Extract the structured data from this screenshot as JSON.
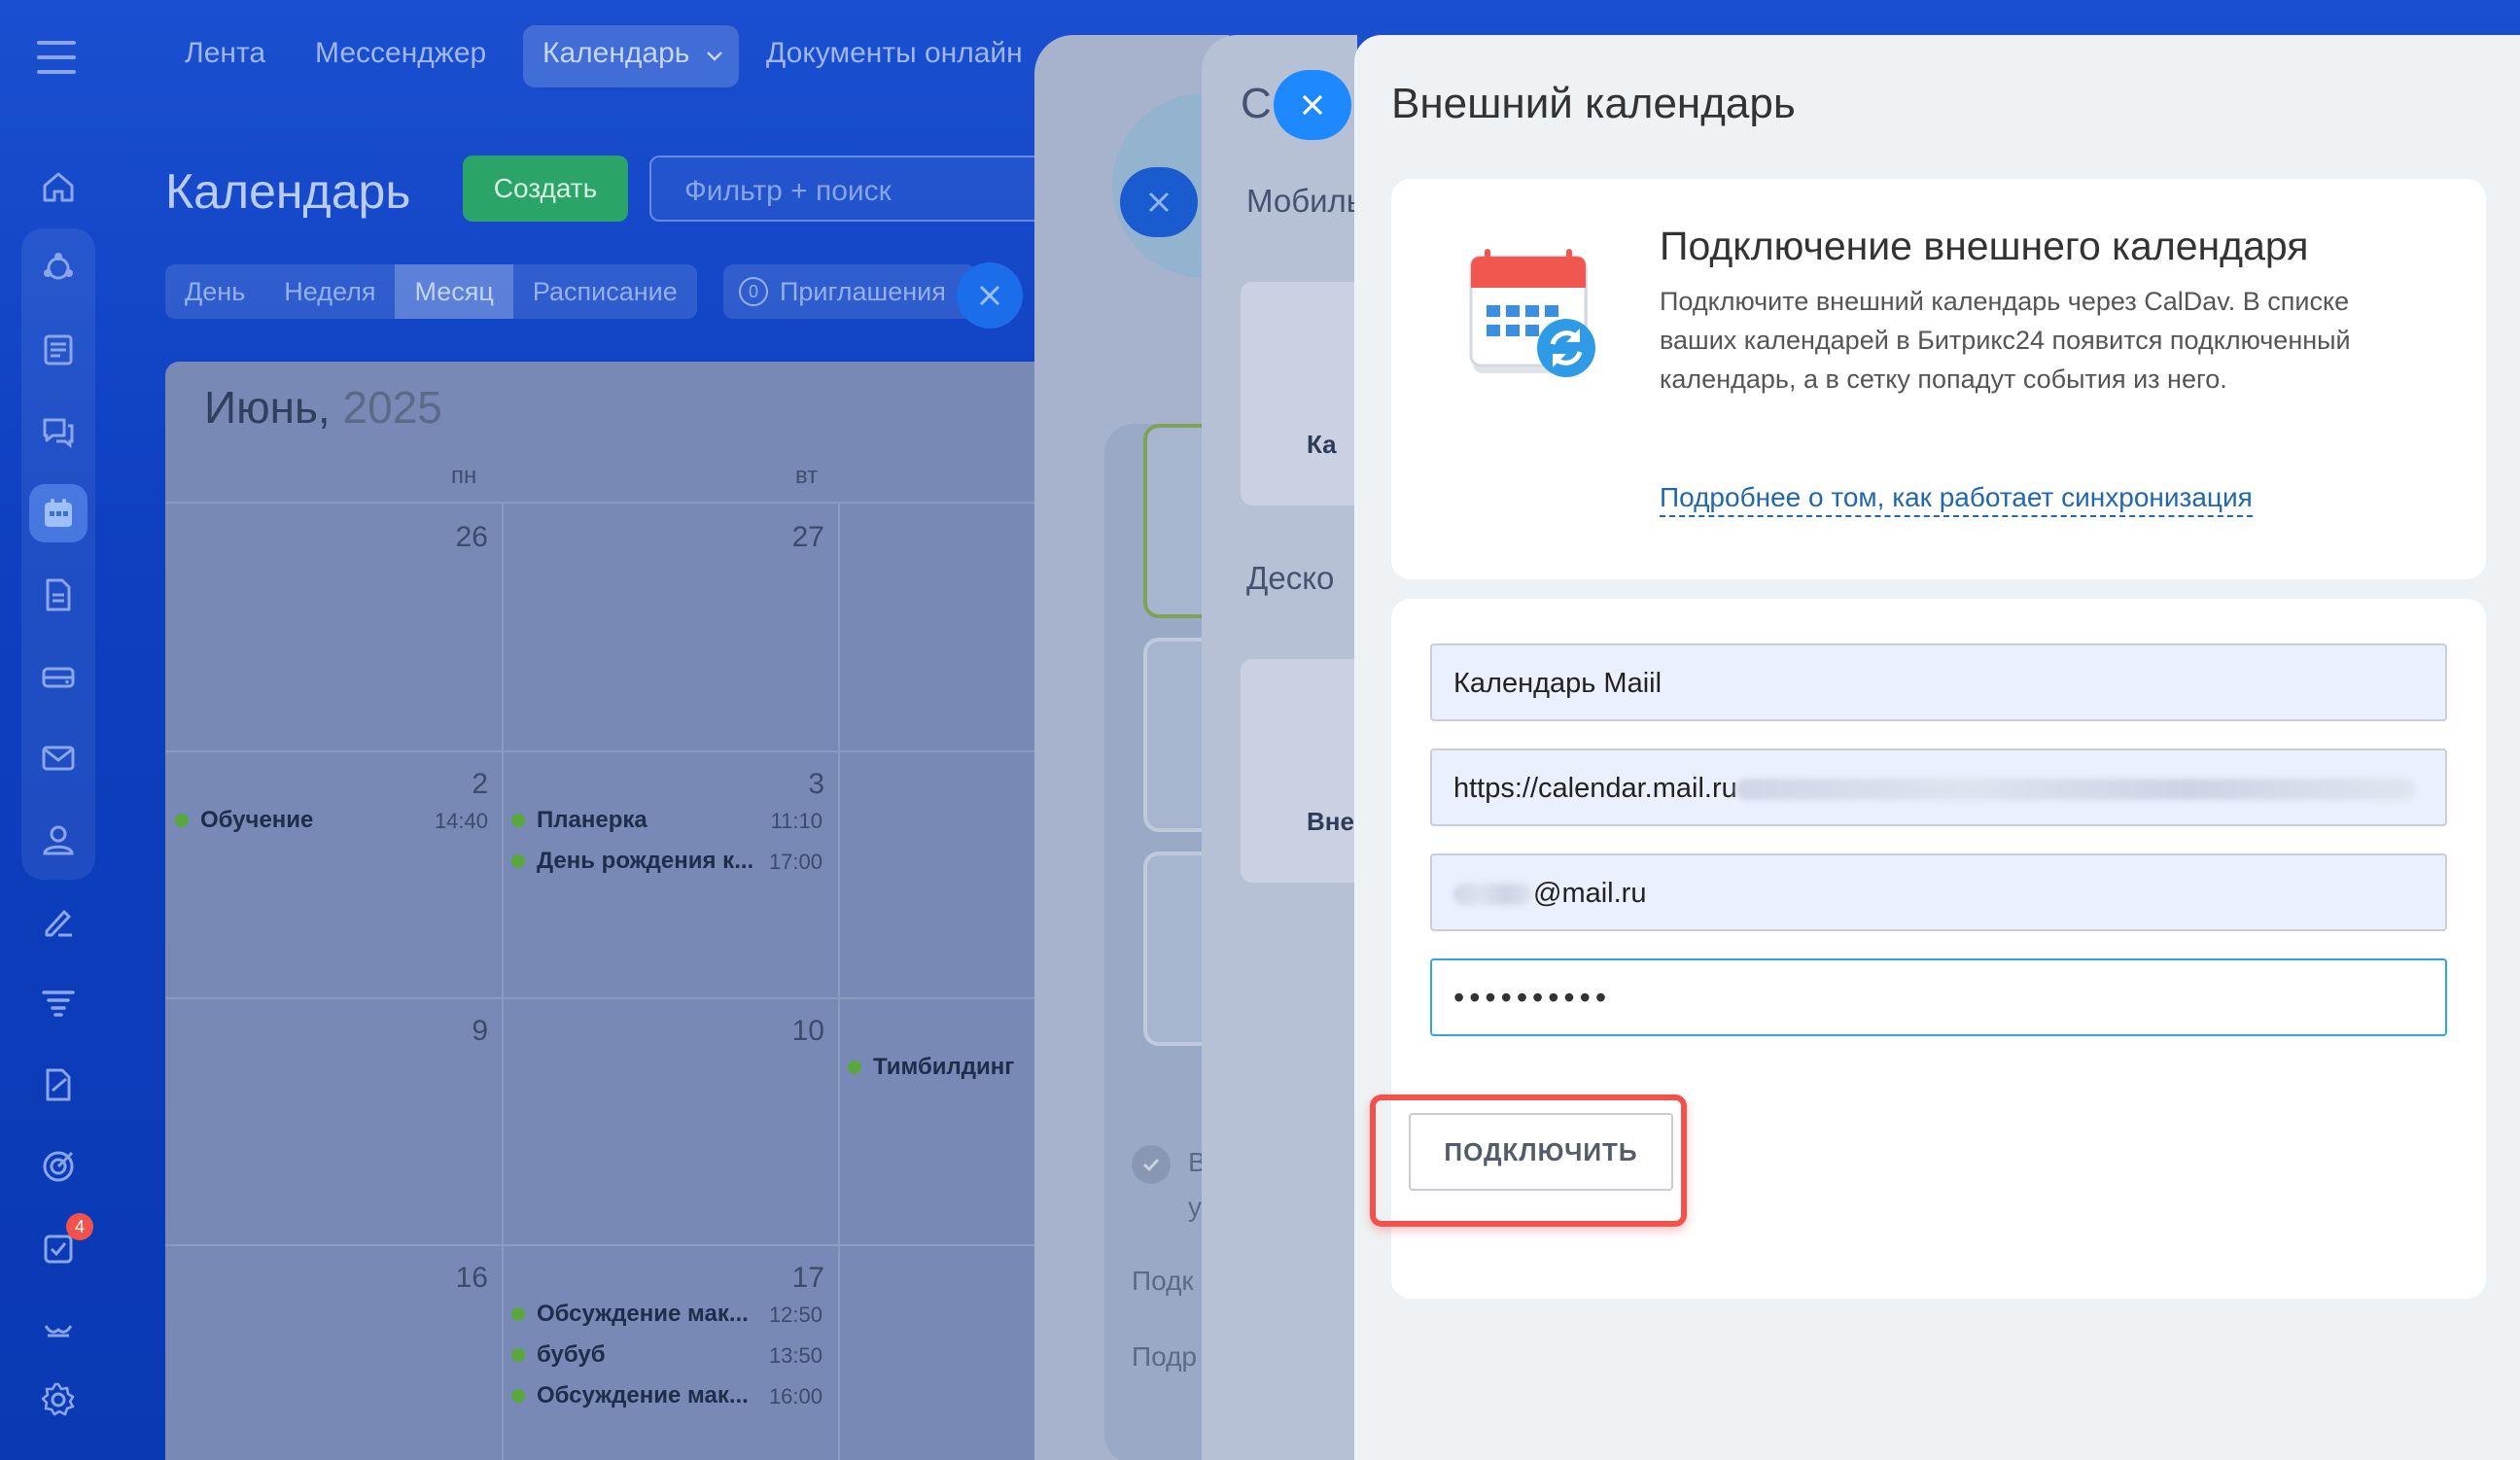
{
  "topnav": {
    "items": [
      "Лента",
      "Мессенджер",
      "Календарь",
      "Документы онлайн"
    ]
  },
  "calendar_page": {
    "title": "Календарь",
    "create_label": "Создать",
    "filter_placeholder": "Фильтр + поиск",
    "views": [
      "День",
      "Неделя",
      "Месяц",
      "Расписание"
    ],
    "active_view": "Месяц",
    "invites_count": "0",
    "invites_label": "Приглашения"
  },
  "calendar_grid": {
    "month": "Июнь,",
    "year": "2025",
    "weekdays": [
      "пн",
      "вт"
    ],
    "days": {
      "d26": "26",
      "d27": "27",
      "d2": "2",
      "d3": "3",
      "d9": "9",
      "d10": "10",
      "d16": "16",
      "d17": "17"
    },
    "events": [
      {
        "title": "Обучение",
        "time": "14:40"
      },
      {
        "title": "Планерка",
        "time": "11:10"
      },
      {
        "title": "День рождения к...",
        "time": "17:00"
      },
      {
        "title": "Тимбилдинг",
        "time": ""
      },
      {
        "title": "Обсуждение мак...",
        "time": "12:50"
      },
      {
        "title": "бубуб",
        "time": "13:50"
      },
      {
        "title": "Обсуждение мак...",
        "time": "16:00"
      }
    ]
  },
  "slider_bg": {
    "s2_title": "С",
    "s2_mobile": "Мобиль",
    "s2_card1": "Ка",
    "s2_desktop": "Деско",
    "s2_card2": "Вне",
    "s1_check_text": "В",
    "s1_check_text2": "у",
    "s1_link1": "Подк",
    "s1_link2": "Подр"
  },
  "panel": {
    "title": "Внешний календарь",
    "info_heading": "Подключение внешнего календаря",
    "info_description": "Подключите внешний календарь через CalDav. В списке ваших календарей в Битрикс24 появится подключенный календарь, а в сетку попадут события из него.",
    "info_link": "Подробнее о том, как работает синхронизация",
    "fields": {
      "name_value": "Календарь Maiil",
      "url_value": "https://calendar.mail.ru",
      "email_value": "@mail.ru",
      "password_value": "••••••••••"
    },
    "connect_label": "ПОДКЛЮЧИТЬ"
  },
  "colors": {
    "accent_blue": "#1e88ff",
    "create_green": "#2aa468",
    "highlight_red": "#f2524b",
    "link_blue": "#2067b0"
  },
  "icons": {
    "menu": "hamburger-icon",
    "rail": [
      "home-icon",
      "plugin-icon",
      "newspaper-icon",
      "chat-icon",
      "calendar-icon",
      "document-icon",
      "drive-icon",
      "mail-icon",
      "users-icon",
      "sign-icon",
      "filter-icon",
      "form-icon",
      "target-icon",
      "tasks-icon",
      "bitrix-icon",
      "settings-icon"
    ],
    "tasks_badge": "4"
  }
}
